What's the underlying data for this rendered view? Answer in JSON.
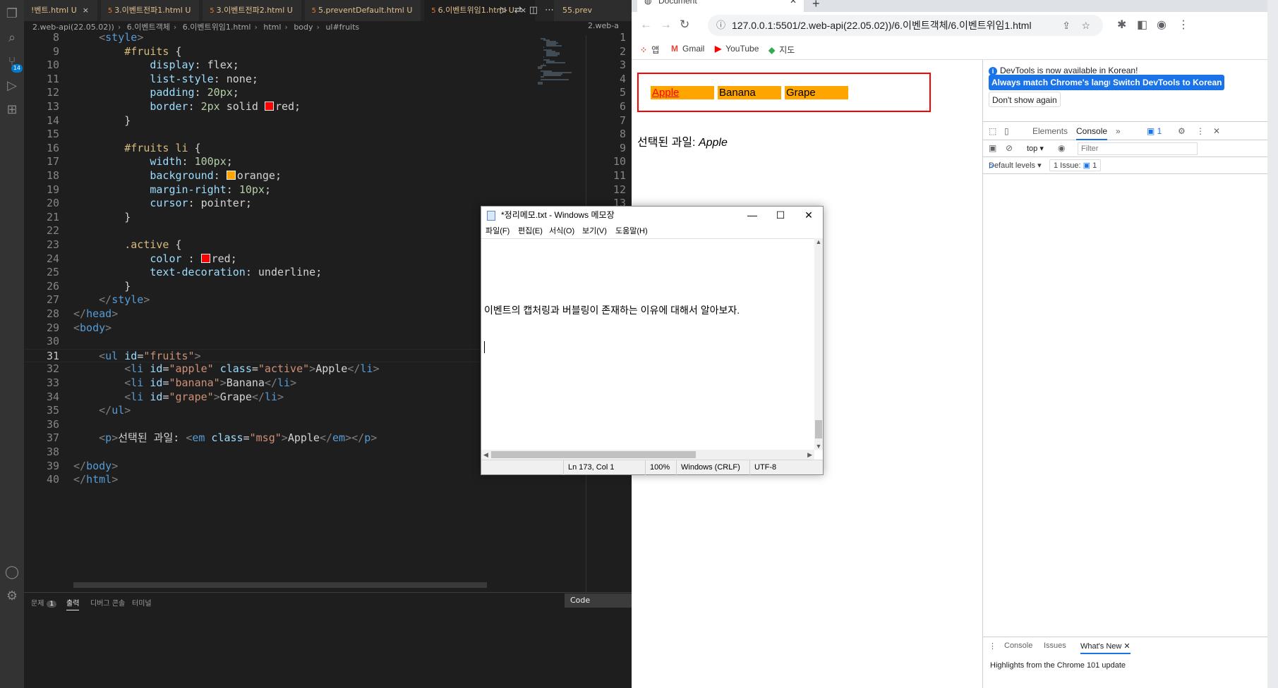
{
  "vscode": {
    "tabs": [
      {
        "label": "!벤트.html",
        "status": "U"
      },
      {
        "label": "3.이벤트전파1.html",
        "status": "U"
      },
      {
        "label": "3.이벤트전파2.html",
        "status": "U"
      },
      {
        "label": "5.preventDefault.html",
        "status": "U"
      },
      {
        "label": "6.이벤트위임1.html",
        "status": "U"
      }
    ],
    "right_tab": "5.prev",
    "breadcrumb": [
      "2.web-api(22.05.02))",
      "6.이벤트객체",
      "6.이벤트위임1.html",
      "html",
      "body",
      "ul#fruits"
    ],
    "right_breadcrumb": "2.web-a",
    "current_line": "31",
    "lines": [
      {
        "n": "8",
        "text": "    <style>"
      },
      {
        "n": "9",
        "text": "        #fruits {"
      },
      {
        "n": "10",
        "text": "            display: flex;"
      },
      {
        "n": "11",
        "text": "            list-style: none;"
      },
      {
        "n": "12",
        "text": "            padding: 20px;"
      },
      {
        "n": "13",
        "text": "            border: 2px solid red;"
      },
      {
        "n": "14",
        "text": "        }"
      },
      {
        "n": "15",
        "text": ""
      },
      {
        "n": "16",
        "text": "        #fruits li {"
      },
      {
        "n": "17",
        "text": "            width: 100px;"
      },
      {
        "n": "18",
        "text": "            background: orange;"
      },
      {
        "n": "19",
        "text": "            margin-right: 10px;"
      },
      {
        "n": "20",
        "text": "            cursor: pointer;"
      },
      {
        "n": "21",
        "text": "        }"
      },
      {
        "n": "22",
        "text": ""
      },
      {
        "n": "23",
        "text": "        .active {"
      },
      {
        "n": "24",
        "text": "            color : red;"
      },
      {
        "n": "25",
        "text": "            text-decoration: underline;"
      },
      {
        "n": "26",
        "text": "        }"
      },
      {
        "n": "27",
        "text": "    </style>"
      },
      {
        "n": "28",
        "text": "</head>"
      },
      {
        "n": "29",
        "text": "<body>"
      },
      {
        "n": "30",
        "text": ""
      },
      {
        "n": "31",
        "text": "    <ul id=\"fruits\">"
      },
      {
        "n": "32",
        "text": "        <li id=\"apple\" class=\"active\">Apple</li>"
      },
      {
        "n": "33",
        "text": "        <li id=\"banana\">Banana</li>"
      },
      {
        "n": "34",
        "text": "        <li id=\"grape\">Grape</li>"
      },
      {
        "n": "35",
        "text": "    </ul>"
      },
      {
        "n": "36",
        "text": ""
      },
      {
        "n": "37",
        "text": "    <p>선택된 과일: <em class=\"msg\">Apple</em></p>"
      },
      {
        "n": "38",
        "text": ""
      },
      {
        "n": "39",
        "text": "</body>"
      },
      {
        "n": "40",
        "text": "</html>"
      }
    ],
    "split_line_numbers": [
      "1",
      "2",
      "3",
      "4",
      "5",
      "6",
      "7",
      "8",
      "9",
      "10",
      "11",
      "12",
      "13"
    ],
    "panel": {
      "tabs": [
        "문제",
        "출력",
        "디버그 콘솔",
        "터미널"
      ],
      "problems_count": "1",
      "output_channel": "Code"
    },
    "activity_badge": "14",
    "colors": {
      "red": "#ff0000",
      "orange": "#ffa500"
    }
  },
  "chrome": {
    "tab_title": "Document",
    "url": "127.0.0.1:5501/2.web-api(22.05.02))/6.이벤트객체/6.이벤트위임1.html",
    "bookmarks": [
      {
        "label": "앱",
        "icon": "apps-grid-icon"
      },
      {
        "label": "Gmail",
        "icon": "gmail-icon"
      },
      {
        "label": "YouTube",
        "icon": "youtube-icon"
      },
      {
        "label": "지도",
        "icon": "maps-icon"
      }
    ],
    "page": {
      "fruits": [
        "Apple",
        "Banana",
        "Grape"
      ],
      "active_fruit": "Apple",
      "msg_label": "선택된 과일:",
      "msg_value": "Apple"
    },
    "devtools": {
      "info_text": "DevTools is now available in Korean!",
      "btn_match": "Always match Chrome's language",
      "btn_switch": "Switch DevTools to Korean",
      "btn_dont": "Don't show again",
      "tabs": [
        "Elements",
        "Console"
      ],
      "issues_badge": "1",
      "context": "top",
      "filter_placeholder": "Filter",
      "levels": "Default levels",
      "issue_count": "1 Issue:",
      "issue_badge": "1",
      "prompt": ">",
      "drawer_tabs": [
        "Console",
        "Issues",
        "What's New"
      ],
      "highlights": "Highlights from the Chrome 101 update"
    }
  },
  "notepad": {
    "title": "*정리메모.txt - Windows 메모장",
    "menu": [
      "파일(F)",
      "편집(E)",
      "서식(O)",
      "보기(V)",
      "도움말(H)"
    ],
    "text": "이벤트의 캡처링과 버블링이 존재하는 이유에 대해서 알아보자.",
    "status": {
      "pos": "Ln 173, Col 1",
      "zoom": "100%",
      "eol": "Windows (CRLF)",
      "enc": "UTF-8"
    }
  }
}
